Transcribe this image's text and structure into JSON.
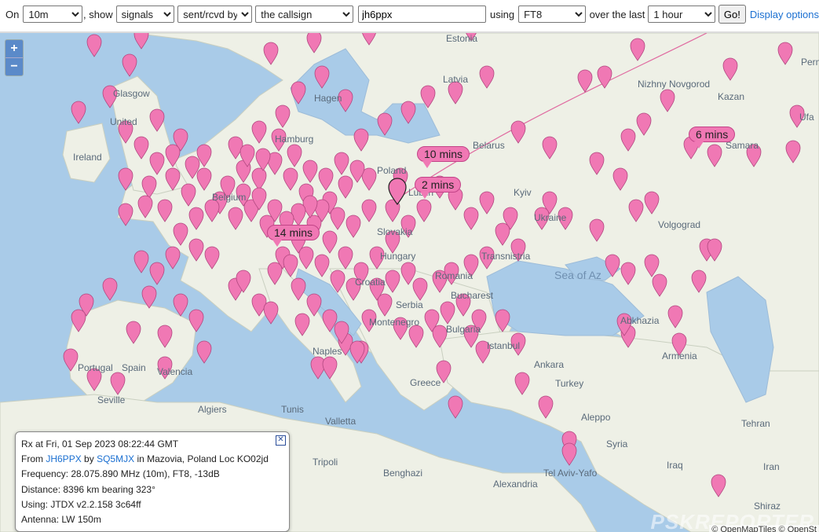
{
  "toolbar": {
    "on_label": "On",
    "band_value": "10m",
    "show_label": ", show",
    "show_value": "signals",
    "direction_value": "sent/rcvd by",
    "target_value": "the callsign",
    "callsign_value": "jh6ppx",
    "using_label": "using",
    "mode_value": "FT8",
    "over_label": "over the last",
    "period_value": "1 hour",
    "go_label": "Go!",
    "display_options_label": "Display options"
  },
  "map": {
    "zoom_in": "+",
    "zoom_out": "−",
    "places": [
      "Estonia",
      "Latvia",
      "Nizhny Novgorod",
      "Kazan",
      "Ufa",
      "Perm",
      "Glasgow",
      "United",
      "Ireland",
      "Belarus",
      "Samara",
      "Kyiv",
      "Ukraine",
      "Volgograd",
      "Transnistria",
      "Hungary",
      "Croatia",
      "Romania",
      "Bucharest",
      "Serbia",
      "Montenegro",
      "Bulgaria",
      "Abkhazia",
      "Armenia",
      "Istanbul",
      "Ankara",
      "Naples",
      "Greece",
      "Turkey",
      "Portugal",
      "Spain",
      "Valencia",
      "Seville",
      "Algiers",
      "Tunis",
      "Valletta",
      "Tripoli",
      "Benghazi",
      "Aleppo",
      "Syria",
      "Iraq",
      "Tehran",
      "Iran",
      "Tel Aviv-Yafo",
      "Alexandria",
      "Shiraz",
      "Hagen",
      "Hamburg",
      "Belgium",
      "Slovakia",
      "Poland",
      "Lublin"
    ],
    "seas": [
      "Sea of Az"
    ],
    "tags": [
      "10 mins",
      "2 mins",
      "14 mins",
      "6 mins"
    ],
    "brand": "PSKREPORTER",
    "attribution": "© OpenMapTiles © OpenSt"
  },
  "popup": {
    "line1": "Rx at Fri, 01 Sep 2023 08:22:44 GMT",
    "from_label": "From",
    "from_call": "JH6PPX",
    "by_label": "by",
    "by_call": "SQ5MJX",
    "location": "in Mazovia, Poland Loc KO02jd",
    "frequency": "Frequency: 28.075.890 MHz (10m), FT8, -13dB",
    "distance": "Distance: 8396 km bearing 323°",
    "using": "Using: JTDX v2.2.158 3c64ff",
    "antenna": "Antenna: LW 150m",
    "close": "✕"
  },
  "colors": {
    "marker": "#f078b4",
    "marker_stroke": "#b0477f",
    "land": "#eef0e6",
    "sea": "#a9cbe8"
  }
}
